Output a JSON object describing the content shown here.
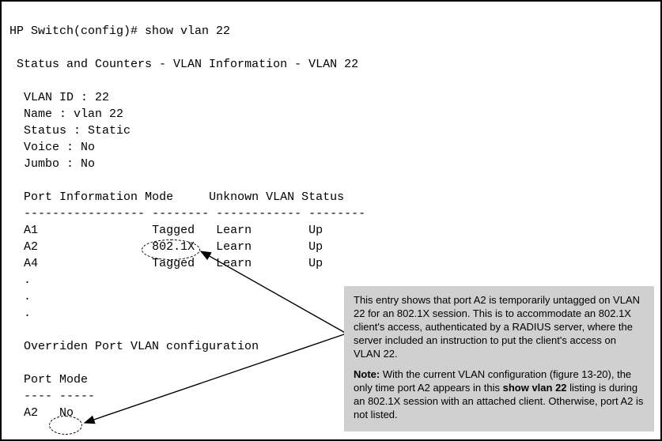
{
  "terminal": {
    "prompt": "HP Switch(config)# show vlan 22",
    "title": "Status and Counters - VLAN Information - VLAN 22",
    "fields": {
      "vlan_id_label": "VLAN ID : ",
      "vlan_id": "22",
      "name_label": "Name : ",
      "name": "vlan 22",
      "status_label": "Status : ",
      "status": "Static",
      "voice_label": "Voice : ",
      "voice": "No",
      "jumbo_label": "Jumbo : ",
      "jumbo": "No"
    },
    "port_info": {
      "headers": {
        "port": "Port Information",
        "mode": "Mode",
        "unknown_vlan": "Unknown VLAN",
        "status": "Status"
      },
      "divider": {
        "c1": "-----------------",
        "c2": "--------",
        "c3": "------------",
        "c4": "--------"
      },
      "rows": [
        {
          "port": "A1",
          "mode": "Tagged",
          "unknown": "Learn",
          "status": "Up"
        },
        {
          "port": "A2",
          "mode": "802.1X",
          "unknown": "Learn",
          "status": "Up"
        },
        {
          "port": "A4",
          "mode": "Tagged",
          "unknown": "Learn",
          "status": "Up"
        }
      ],
      "ellipsis": "."
    },
    "override": {
      "title": "Overriden Port VLAN configuration",
      "headers": {
        "port": "Port",
        "mode": "Mode"
      },
      "divider": {
        "c1": "----",
        "c2": "-----"
      },
      "row": {
        "port": "A2",
        "mode": "No"
      }
    }
  },
  "callout": {
    "para1_a": "This entry shows that port A2 is temporarily untagged on VLAN 22 for an 802.1X session. This is to accommodate an 802.1X client's access, authenticated by a RADIUS server, where the server included an instruction to put the client's access on VLAN 22.",
    "note_label": "Note:",
    "para2_a": " With the current VLAN configuration (figure 13-20), the only time port A2 appears in this ",
    "bold_cmd": "show vlan 22",
    "para2_b": " listing is during an 802.1X session with an attached client. Otherwise, port A2 is not listed."
  }
}
